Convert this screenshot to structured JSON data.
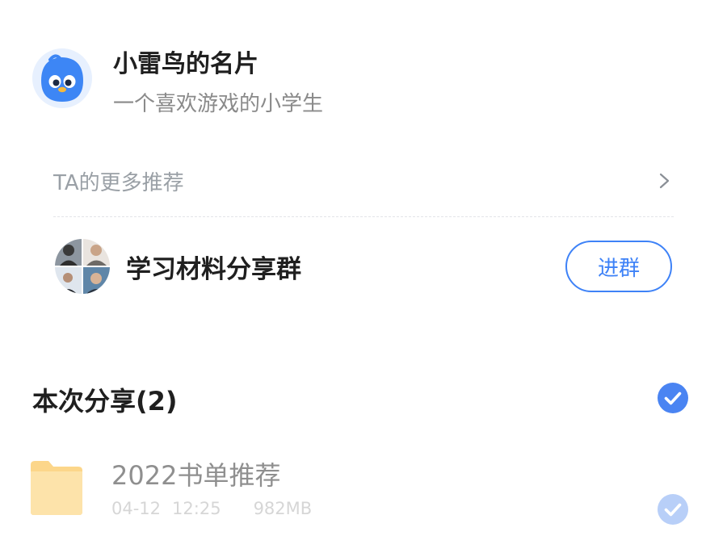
{
  "profile": {
    "name": "小雷鸟的名片",
    "bio": "一个喜欢游戏的小学生",
    "avatar_icon": "bird-mascot-icon"
  },
  "recommendations": {
    "label": "TA的更多推荐",
    "chevron_icon": "chevron-right-icon"
  },
  "group": {
    "name": "学习材料分享群",
    "join_label": "进群"
  },
  "share": {
    "title": "本次分享(2)",
    "checked": true
  },
  "files": [
    {
      "name": "2022书单推荐",
      "date": "04-12",
      "time": "12:25",
      "size": "982MB",
      "checked": true
    }
  ],
  "colors": {
    "accent": "#3e82f7",
    "check": "#4a84f2",
    "check_dim": "#b8cff8",
    "folder": "#fde0a0"
  }
}
